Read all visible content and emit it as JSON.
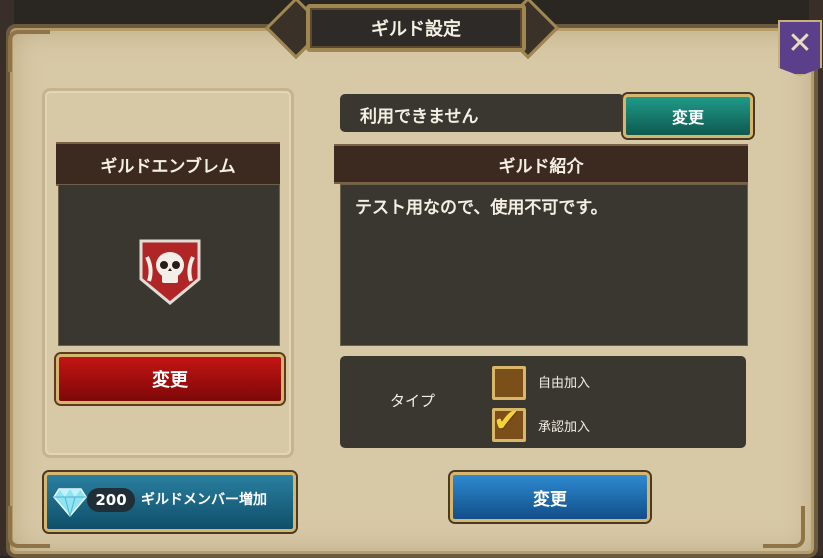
{
  "window": {
    "title": "ギルド設定",
    "close_icon": "close-icon"
  },
  "emblem": {
    "title": "ギルドエンブレム",
    "image_icon": "skull-emblem-icon",
    "change_button": "変更"
  },
  "member_upgrade": {
    "gem_icon": "diamond-gem-icon",
    "cost": "200",
    "label": "ギルドメンバー増加"
  },
  "guild_name": {
    "status": "利用できません",
    "change_button": "変更"
  },
  "introduction": {
    "title": "ギルド紹介",
    "text": "テスト用なので、使用不可です。"
  },
  "join_type": {
    "label": "タイプ",
    "options": [
      {
        "label": "自由加入",
        "checked": false
      },
      {
        "label": "承認加入",
        "checked": true
      }
    ]
  },
  "confirm_button": "変更",
  "colors": {
    "panel": "#d8c9a6",
    "dark_box": "#3a3630",
    "red_button": "#c41414",
    "green_button": "#1f9a88",
    "blue_button": "#2e8ad0",
    "close_purple": "#5b3f8a"
  }
}
